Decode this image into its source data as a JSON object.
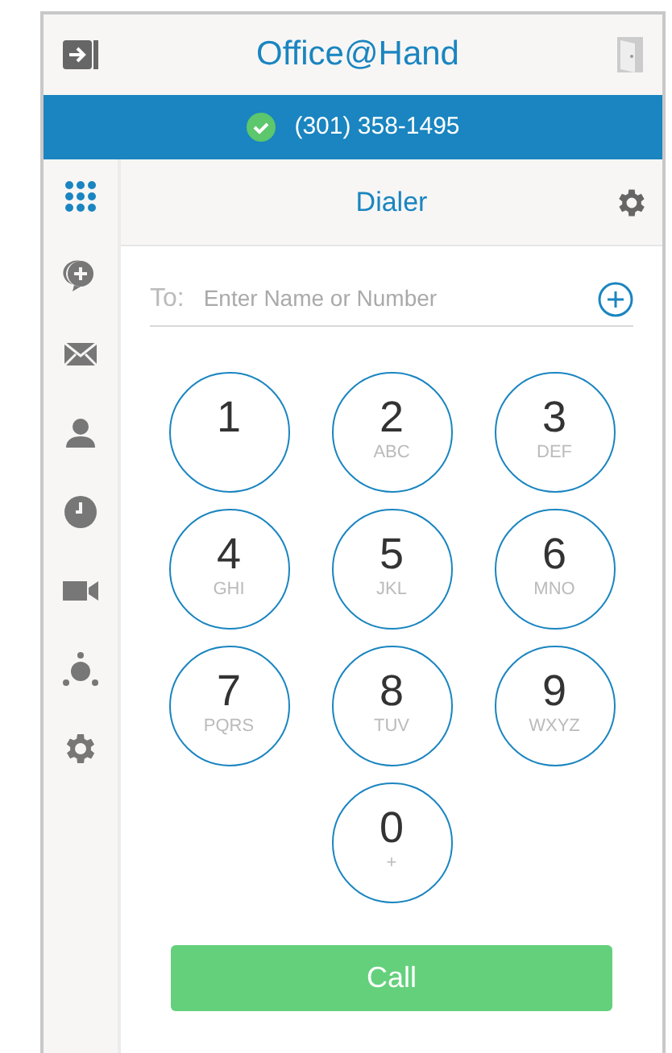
{
  "header": {
    "title": "Office@Hand"
  },
  "status": {
    "number": "(301) 358-1495"
  },
  "nav": [
    {
      "kind": "dialpad",
      "selected": true
    },
    {
      "kind": "messages",
      "selected": false
    },
    {
      "kind": "mail",
      "selected": false
    },
    {
      "kind": "contacts",
      "selected": false
    },
    {
      "kind": "history",
      "selected": false
    },
    {
      "kind": "video",
      "selected": false
    },
    {
      "kind": "conference",
      "selected": false
    },
    {
      "kind": "settings",
      "selected": false
    }
  ],
  "dialer": {
    "title": "Dialer",
    "to_label": "To:",
    "placeholder": "Enter Name or Number",
    "keys": [
      {
        "digit": "1"
      },
      {
        "digit": "2",
        "letters": "ABC"
      },
      {
        "digit": "3",
        "letters": "DEF"
      },
      {
        "digit": "4",
        "letters": "GHI"
      },
      {
        "digit": "5",
        "letters": "JKL"
      },
      {
        "digit": "6",
        "letters": "MNO"
      },
      {
        "digit": "7",
        "letters": "PQRS"
      },
      {
        "digit": "8",
        "letters": "TUV"
      },
      {
        "digit": "9",
        "letters": "WXYZ"
      },
      {
        "digit": "0",
        "letters": "+"
      }
    ],
    "call_label": "Call"
  }
}
